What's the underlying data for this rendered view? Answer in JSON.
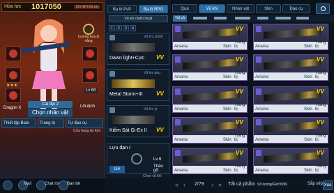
{
  "power": {
    "label": "Hỏa lực",
    "value": "1017050",
    "sub": "Chi tiết hỏa lực"
  },
  "character": {
    "emblem_label": "Cường hóa\ndi năng",
    "level_badge": "Lv 60",
    "donor_label": "Lõi dịnh",
    "name_badge": "Dragon X",
    "tag_label": "Cái đẹt 2",
    "choose_button": "Chọn nhân vật",
    "stars": "★★★"
  },
  "bottom_tabs": [
    "Thiết lập Bale",
    "Trang bị",
    "Tự đạo cụ"
  ],
  "diamond_label": "Cửa hàng đá Kim",
  "middle": {
    "tabs": [
      {
        "label": "Ba lô PvP",
        "active": false
      },
      {
        "label": "Ba lô RPG",
        "active": true
      }
    ],
    "preset_label": "Vũ khí chiến thuật",
    "pages": [
      "1",
      "2",
      "3",
      "4"
    ],
    "slots": [
      {
        "caption": "Vũ khí chính",
        "name": "Dawn light+Cực",
        "vv": "VV",
        "gold": false
      },
      {
        "caption": "Vũ khí phụ",
        "name": "Metal Storm+III",
        "vv": "VV",
        "gold": true
      },
      {
        "caption": "Vũ khí tỷ",
        "name": "Kiếm Sát Gi-Ex II",
        "vv": "VV",
        "gold": false
      }
    ],
    "grenade": {
      "title": "Lựu đạn I",
      "button": "Gỡ",
      "level": "Lv 6",
      "tag": "Tháo gỡ"
    },
    "footer": "Chọn vũ khí"
  },
  "right": {
    "tabs": [
      "Quà",
      "Vũ khí",
      "Nhân vật",
      "Skin",
      "Đạo cụ"
    ],
    "active_tab": "Vũ khí",
    "filter_all": "Tất cả",
    "cards": [
      {
        "name": "Arsena",
        "vv": "VV",
        "skin": "Skin",
        "equip": "Trang bị"
      },
      {
        "name": "Arsena",
        "vv": "VV",
        "skin": "Skin",
        "equip": "Trang bị"
      },
      {
        "name": "Arsena",
        "vv": "VV",
        "skin": "Skin",
        "equip": "Trang bị"
      },
      {
        "name": "Arsena",
        "vv": "VV",
        "skin": "Skin",
        "equip": "Trang bị"
      },
      {
        "name": "Arsena",
        "vv": "VV",
        "skin": "Skin",
        "equip": "Trang bị"
      },
      {
        "name": "Arsena",
        "vv": "VV",
        "skin": "Skin",
        "equip": "Trang bị"
      },
      {
        "name": "Arsena",
        "vv": "VV",
        "skin": "Skin",
        "equip": "Trang bị"
      },
      {
        "name": "Arsena",
        "vv": "VV",
        "skin": "Skin",
        "equip": "Trang bị"
      },
      {
        "name": "Arsena",
        "vv": "VV",
        "skin": "Skin",
        "equip": "Trang bị"
      },
      {
        "name": "Arsena",
        "vv": "VV",
        "skin": "Skin",
        "equip": "Trang bị"
      }
    ],
    "pager": {
      "page": "2/79",
      "filter": "Tất cả phẩm",
      "capacity": "Số lượng/Giới:6/99",
      "sort": "Sắp xếp",
      "lock": "Xóa"
    }
  },
  "footer": {
    "items": [
      "Mail",
      "Chat room",
      "Bạn bè"
    ]
  }
}
